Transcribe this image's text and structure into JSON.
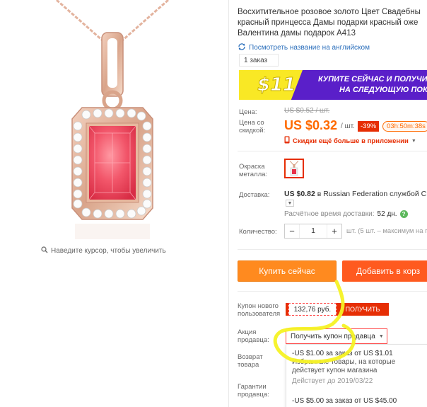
{
  "product": {
    "title_lines": [
      "Восхитительное розовое золото Цвет Свадебны",
      "красный принцесса Дамы подарки красный оже",
      "Валентина дамы подарок A413"
    ],
    "translate_link": "Посмотреть название на английском",
    "orders": "1 заказ",
    "zoom_hint": "Наведите курсор, чтобы увеличить"
  },
  "promo": {
    "badge": "$11",
    "line1": "КУПИТЕ СЕЙЧАС И ПОЛУЧИТ",
    "line2": "НА СЛЕДУЮЩУЮ ПОК"
  },
  "price": {
    "label_price": "Цена:",
    "label_discount_1": "Цена со",
    "label_discount_2": "скидкой:",
    "old": "US $0.52 / шт.",
    "current": "US $0.32",
    "per_unit": "/ шт.",
    "discount": "-39%",
    "timer": "03h:50m:38s",
    "app_discount": "Скидки ещё больше в приложении"
  },
  "options": {
    "color_label_1": "Окраска",
    "color_label_2": "металла:"
  },
  "shipping": {
    "label": "Доставка:",
    "price": "US $0.82",
    "text": " в Russian Federation службой Chi",
    "delivery_label": "Расчётное время доставки:",
    "delivery_value": "52 дн."
  },
  "quantity": {
    "label": "Количество:",
    "minus": "−",
    "value": "1",
    "plus": "+",
    "note": "шт. (5 шт. – максимум на п"
  },
  "actions": {
    "buy_now": "Купить сейчас",
    "add_to_cart": "Добавить в корз"
  },
  "coupons": {
    "new_user_label_1": "Купон нового",
    "new_user_label_2": "пользователя",
    "new_user_amount": "132,76 руб.",
    "get_button": "ПОЛУЧИТЬ",
    "seller_label_1": "Акция",
    "seller_label_2": "продавца:",
    "seller_dropdown": "Получить купон продавца",
    "return_label_1": "Возврат",
    "return_label_2": "товара",
    "guarantee_label_1": "Гарантии",
    "guarantee_label_2": "продавца:",
    "dropdown_items": [
      "-US $1.00 за заказ от US $1.01",
      "Избранные товары, на которые",
      "действует купон магазина",
      "Действует до 2019/03/22",
      "-US $5.00 за заказ от US $45.00"
    ]
  },
  "colors": {
    "accent_orange": "#ff6a00",
    "sale_red": "#e62e04",
    "promo_purple": "#5a1fc9",
    "promo_yellow": "#f9e825",
    "annotation_yellow": "#f5f224",
    "link_blue": "#2a6ebb"
  }
}
